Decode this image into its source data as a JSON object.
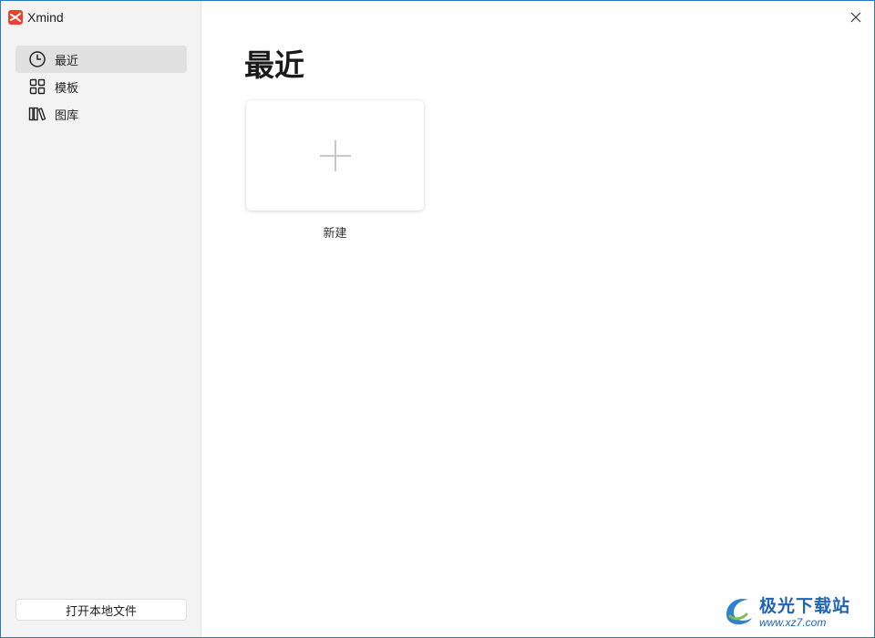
{
  "app": {
    "name": "Xmind"
  },
  "sidebar": {
    "items": [
      {
        "label": "最近",
        "icon": "clock-icon",
        "active": true
      },
      {
        "label": "模板",
        "icon": "grid-icon",
        "active": false
      },
      {
        "label": "图库",
        "icon": "library-icon",
        "active": false
      }
    ],
    "open_local_label": "打开本地文件"
  },
  "main": {
    "title": "最近",
    "new_card_label": "新建"
  },
  "watermark": {
    "name": "极光下载站",
    "url": "www.xz7.com"
  },
  "colors": {
    "sidebar_bg": "#f3f3f3",
    "active_item_bg": "#e1e1e1",
    "brand_red": "#e8432f",
    "window_border": "#2b79c2"
  }
}
